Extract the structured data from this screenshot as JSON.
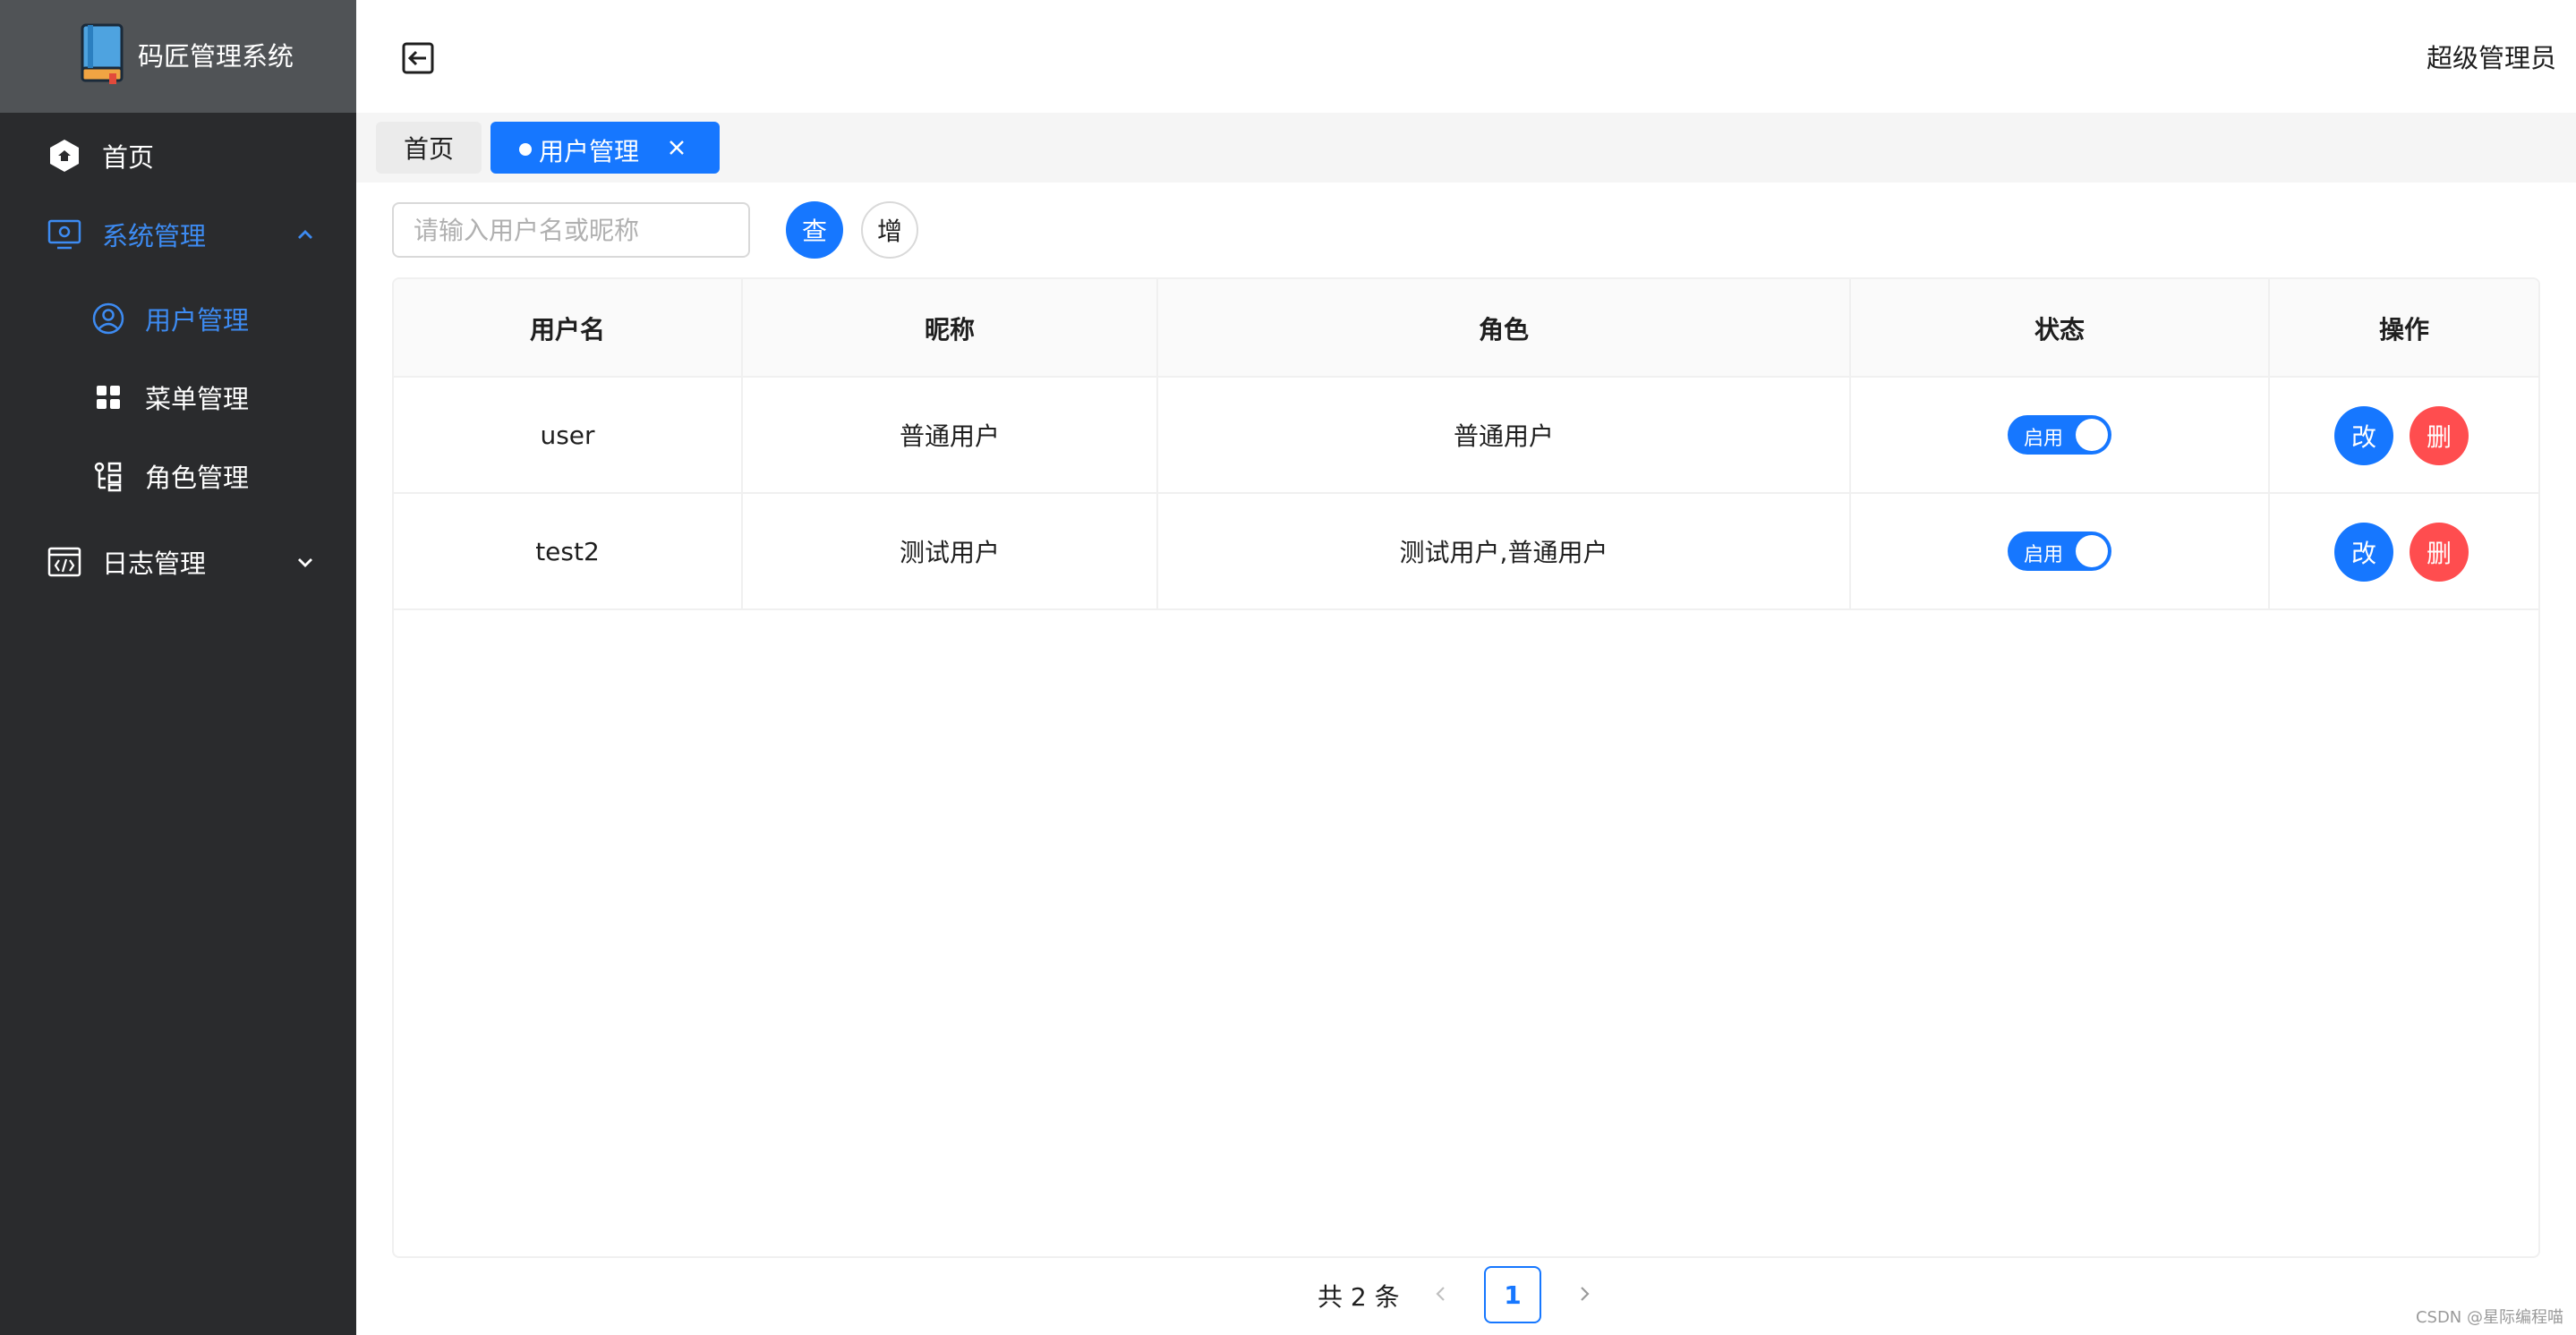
{
  "app": {
    "title": "码匠管理系统"
  },
  "header": {
    "user_name": "超级管理员"
  },
  "sidebar": {
    "items": [
      {
        "label": "首页",
        "icon": "hexagon-home-icon"
      },
      {
        "label": "系统管理",
        "icon": "monitor-settings-icon",
        "expanded": true,
        "children": [
          {
            "label": "用户管理",
            "icon": "user-circle-icon",
            "active": true
          },
          {
            "label": "菜单管理",
            "icon": "grid-menu-icon"
          },
          {
            "label": "角色管理",
            "icon": "role-list-icon"
          }
        ]
      },
      {
        "label": "日志管理",
        "icon": "code-log-icon",
        "expanded": false
      }
    ]
  },
  "tabs": [
    {
      "label": "首页",
      "active": false
    },
    {
      "label": "用户管理",
      "active": true
    }
  ],
  "toolbar": {
    "search_placeholder": "请输入用户名或昵称",
    "search_label": "查",
    "add_label": "增"
  },
  "table": {
    "columns": [
      "用户名",
      "昵称",
      "角色",
      "状态",
      "操作"
    ],
    "rows": [
      {
        "username": "user",
        "nickname": "普通用户",
        "roles": "普通用户",
        "status": "启用",
        "edit": "改",
        "delete": "删"
      },
      {
        "username": "test2",
        "nickname": "测试用户",
        "roles": "测试用户,普通用户",
        "status": "启用",
        "edit": "改",
        "delete": "删"
      }
    ]
  },
  "pagination": {
    "total": "共 2 条",
    "current": "1"
  },
  "watermark": "CSDN @星际编程喵",
  "colors": {
    "primary": "#1677ff",
    "danger": "#ff4d4f",
    "sidebar": "#2a2b2d",
    "logo_bar": "#505356",
    "active_text": "#3d8bf2"
  }
}
